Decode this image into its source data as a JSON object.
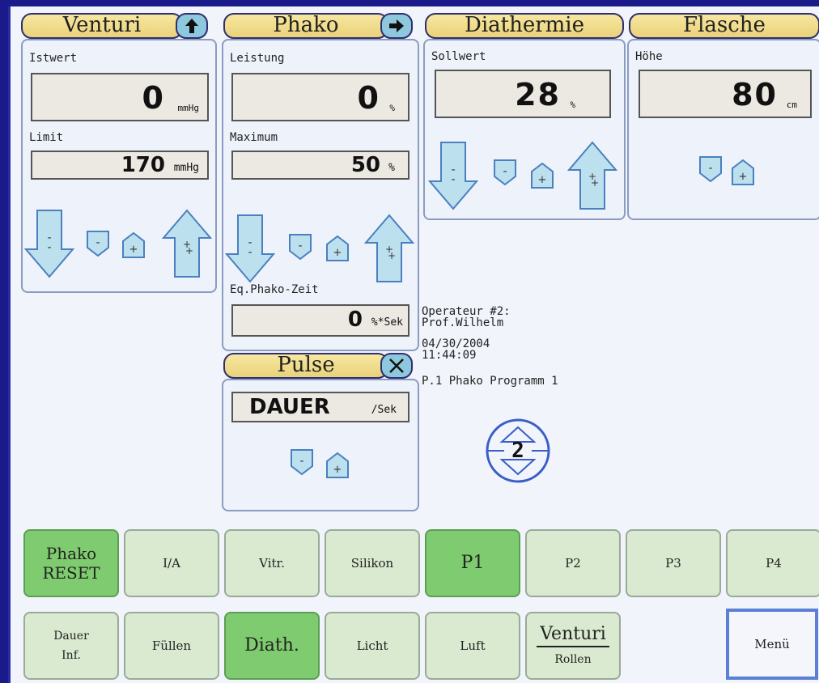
{
  "venturi": {
    "title": "Venturi",
    "istwert_label": "Istwert",
    "istwert_value": "0",
    "istwert_unit": "mmHg",
    "limit_label": "Limit",
    "limit_value": "170",
    "limit_unit": "mmHg"
  },
  "phako": {
    "title": "Phako",
    "leistung_label": "Leistung",
    "leistung_value": "0",
    "leistung_unit": "%",
    "maximum_label": "Maximum",
    "maximum_value": "50",
    "maximum_unit": "%",
    "eq_label": "Eq.Phako-Zeit",
    "eq_value": "0",
    "eq_unit": "%*Sek"
  },
  "diathermie": {
    "title": "Diathermie",
    "sollwert_label": "Sollwert",
    "sollwert_value": "28",
    "sollwert_unit": "%"
  },
  "flasche": {
    "title": "Flasche",
    "hoehe_label": "Höhe",
    "hoehe_value": "80",
    "hoehe_unit": "cm"
  },
  "pulse": {
    "title": "Pulse",
    "dauer_value": "DAUER",
    "dauer_unit": "/Sek"
  },
  "info": {
    "operator_line1": "Operateur #2:",
    "operator_line2": "Prof.Wilhelm",
    "date": "04/30/2004",
    "time": "11:44:09",
    "program": "P.1 Phako Programm 1",
    "dial_value": "2"
  },
  "buttons_row1": [
    "Phako RESET",
    "I/A",
    "Vitr.",
    "Silikon",
    "P1",
    "P2",
    "P3",
    "P4"
  ],
  "buttons_row2": {
    "dauer_line1": "Dauer",
    "dauer_line2": "Inf.",
    "fuellen": "Füllen",
    "diath": "Diath.",
    "licht": "Licht",
    "luft": "Luft",
    "venturi_top": "Venturi",
    "venturi_bottom": "Rollen",
    "menu": "Menü"
  },
  "colors": {
    "background": "#1a1a8a",
    "screen": "#f1f4fb",
    "tab": "#f0dc8a",
    "arrow_fill": "#bde0ee",
    "active_button": "#7fcc70",
    "button": "#d9ead0",
    "menu_border": "#5a7fd6"
  },
  "icons": [
    "arrow-up-icon",
    "arrow-right-icon",
    "close-icon",
    "down-arrow-big-icon",
    "minus-shield-icon",
    "plus-house-icon",
    "up-arrow-big-icon",
    "program-dial-icon"
  ]
}
